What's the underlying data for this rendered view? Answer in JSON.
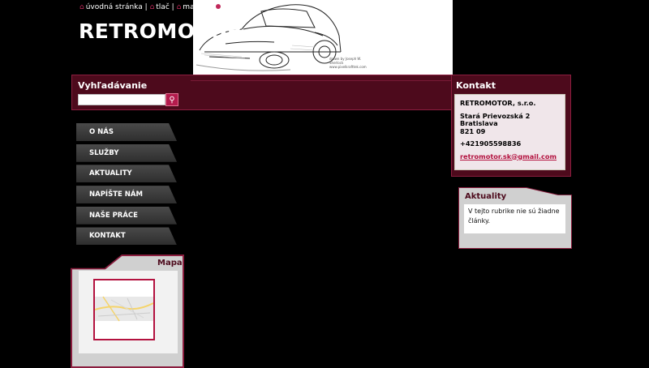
{
  "topnav": {
    "home": "úvodná stránka",
    "sep1": "|",
    "print": "tlač",
    "sep2": "|",
    "sitemap": "mapa st"
  },
  "site": {
    "title": "RETROMOTOR"
  },
  "hero": {
    "credit": "drawn by Joseph W. Sherlock www.pixelkrafttek.com"
  },
  "search": {
    "title": "Vyhľadávanie",
    "placeholder": "",
    "value": ""
  },
  "menu": {
    "items": [
      {
        "label": "O NÁS"
      },
      {
        "label": "SLUŽBY"
      },
      {
        "label": "AKTUALITY"
      },
      {
        "label": "NAPÍŠTE NÁM"
      },
      {
        "label": "NAŠE PRÁCE"
      },
      {
        "label": "KONTAKT"
      }
    ]
  },
  "contact": {
    "title": "Kontakt",
    "company": "RETROMOTOR, s.r.o.",
    "street": "Stará Prievozská 2",
    "city": "Bratislava",
    "zip": "821 09",
    "phone": "+421905598836",
    "email": "retromotor.sk@gmail.com"
  },
  "news": {
    "title": "Aktuality",
    "text": "V tejto rubrike nie sú žiadne články."
  },
  "map": {
    "title": "Mapa"
  },
  "colors": {
    "accent": "#8b1e3f",
    "bar": "#4d0a1c",
    "link": "#b3123f"
  }
}
